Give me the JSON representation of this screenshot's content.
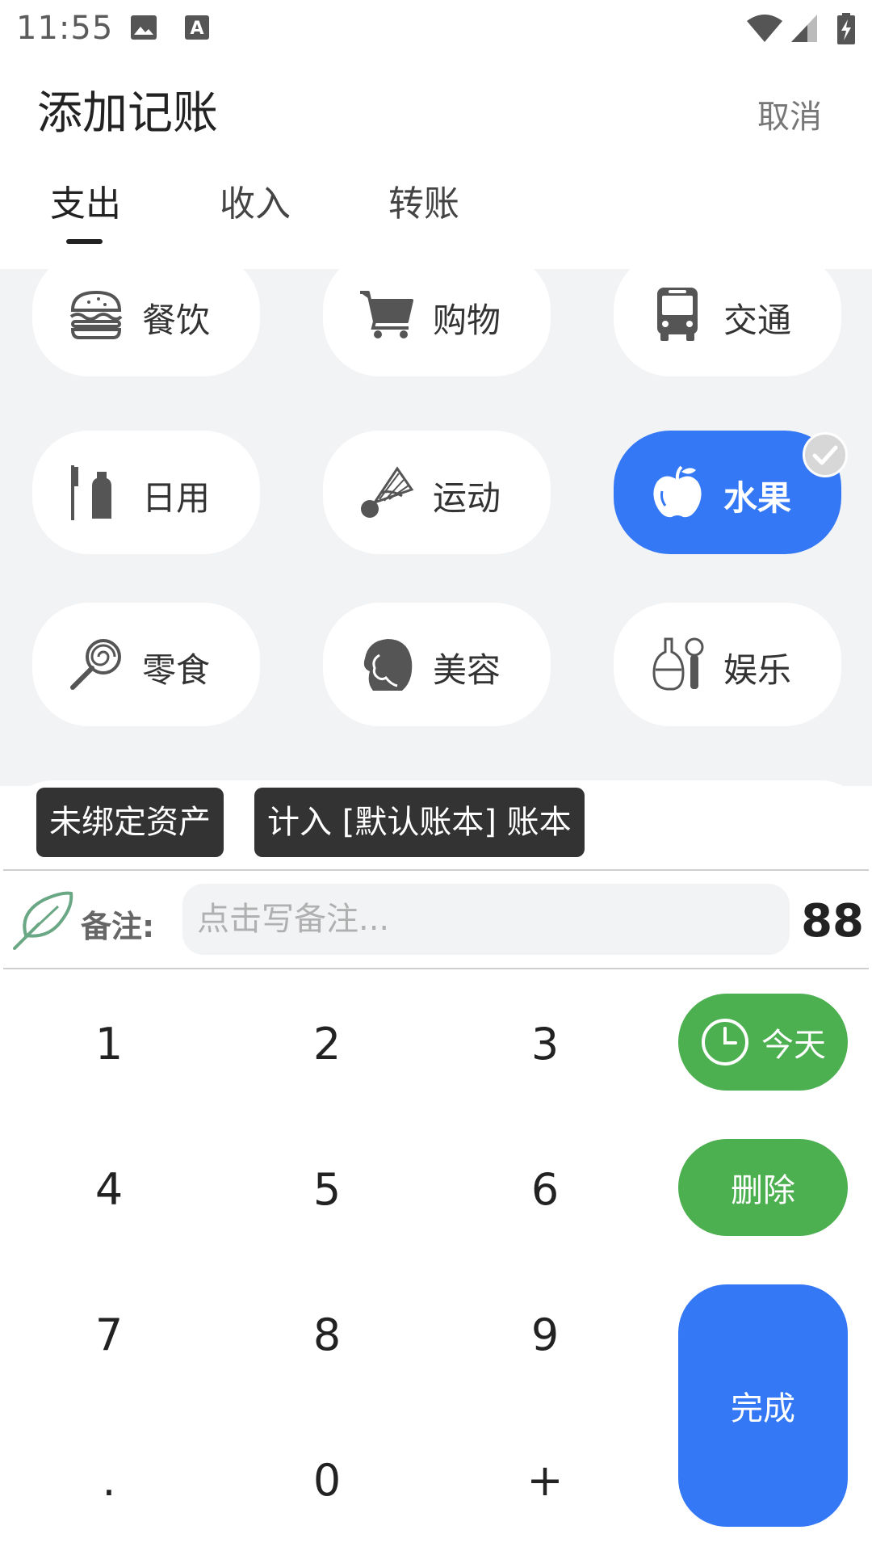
{
  "status_bar": {
    "time": "11:55",
    "icons": [
      "image-icon",
      "text-a-icon",
      "wifi-icon",
      "cellular-signal-icon",
      "battery-charging-icon"
    ]
  },
  "header": {
    "title": "添加记账",
    "cancel_label": "取消"
  },
  "tabs": [
    {
      "label": "支出",
      "active": true
    },
    {
      "label": "收入",
      "active": false
    },
    {
      "label": "转账",
      "active": false
    }
  ],
  "categories": [
    {
      "label": "餐饮",
      "icon": "burger-icon"
    },
    {
      "label": "购物",
      "icon": "shopping-cart-icon"
    },
    {
      "label": "交通",
      "icon": "bus-icon"
    },
    {
      "label": "日用",
      "icon": "toothbrush-toothpaste-icon"
    },
    {
      "label": "运动",
      "icon": "shuttlecock-icon"
    },
    {
      "label": "水果",
      "icon": "apple-icon",
      "selected": true
    },
    {
      "label": "零食",
      "icon": "lollipop-icon"
    },
    {
      "label": "美容",
      "icon": "woman-face-icon"
    },
    {
      "label": "娱乐",
      "icon": "microphone-icon"
    }
  ],
  "tags": {
    "asset": "未绑定资产",
    "book": "计入 [默认账本] 账本"
  },
  "memo": {
    "label": "备注:",
    "placeholder": "点击写备注..."
  },
  "amount": "88",
  "keypad": {
    "keys": [
      "1",
      "2",
      "3",
      "4",
      "5",
      "6",
      "7",
      "8",
      "9",
      ".",
      "0",
      "+"
    ],
    "today_label": "今天",
    "delete_label": "删除",
    "done_label": "完成"
  },
  "colors": {
    "accent_blue": "#3478f6",
    "green": "#4caf50",
    "tag_dark": "#333333",
    "category_bg": "#f2f3f5"
  }
}
